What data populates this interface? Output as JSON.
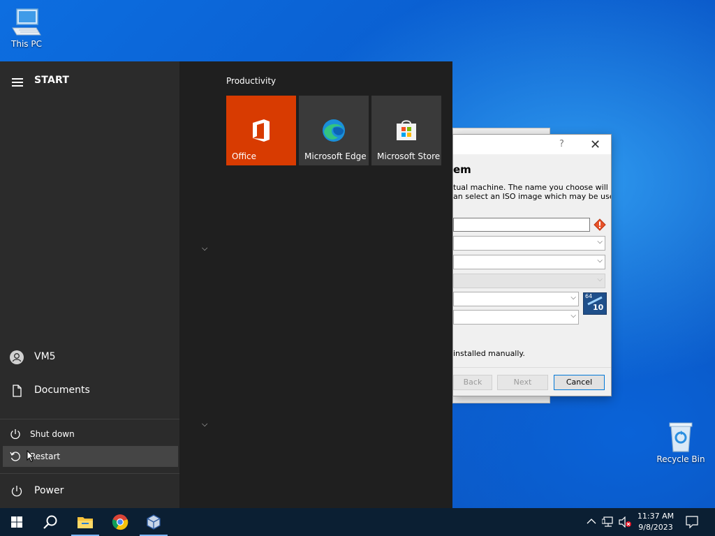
{
  "desktop": {
    "icons": [
      {
        "label": "This PC"
      },
      {
        "label": "Recycle Bin"
      }
    ]
  },
  "dialog": {
    "help_glyph": "?",
    "close_glyph": "✕",
    "heading": "em",
    "desc_line1": "tual machine. The name you choose will be",
    "desc_line2": "an select an ISO image which may be used",
    "note": "installed manually.",
    "buttons": {
      "back": "Back",
      "next": "Next",
      "cancel": "Cancel"
    },
    "os_badge": {
      "bits": "64",
      "version": "10"
    }
  },
  "start": {
    "title": "START",
    "group": "Productivity",
    "tiles": [
      {
        "label": "Office",
        "icon": "office-icon",
        "color": "#d83b01"
      },
      {
        "label": "Microsoft Edge",
        "icon": "edge-icon",
        "color": "#3a3a3a"
      },
      {
        "label": "Microsoft Store",
        "icon": "store-icon",
        "color": "#3a3a3a"
      }
    ],
    "user": "VM5",
    "documents": "Documents",
    "power_menu": {
      "shutdown": "Shut down",
      "restart": "Restart"
    },
    "power": "Power"
  },
  "tray": {
    "time": "11:37 AM",
    "date": "9/8/2023"
  }
}
